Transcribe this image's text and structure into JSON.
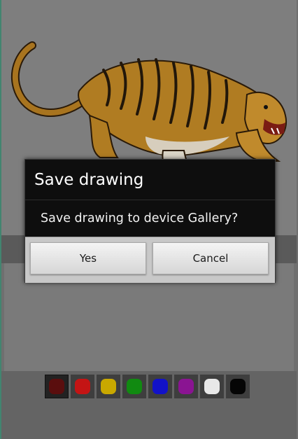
{
  "dialog": {
    "title": "Save drawing",
    "message": "Save drawing to device Gallery?",
    "yes_label": "Yes",
    "cancel_label": "Cancel"
  },
  "palette": {
    "colors": [
      "#5a0e0e",
      "#c41414",
      "#c9a800",
      "#118a11",
      "#1212c8",
      "#8a1492",
      "#e8e8e8",
      "#050505"
    ],
    "selected_index": 0
  },
  "drawing": {
    "subject_icon": "tiger-illustration"
  }
}
